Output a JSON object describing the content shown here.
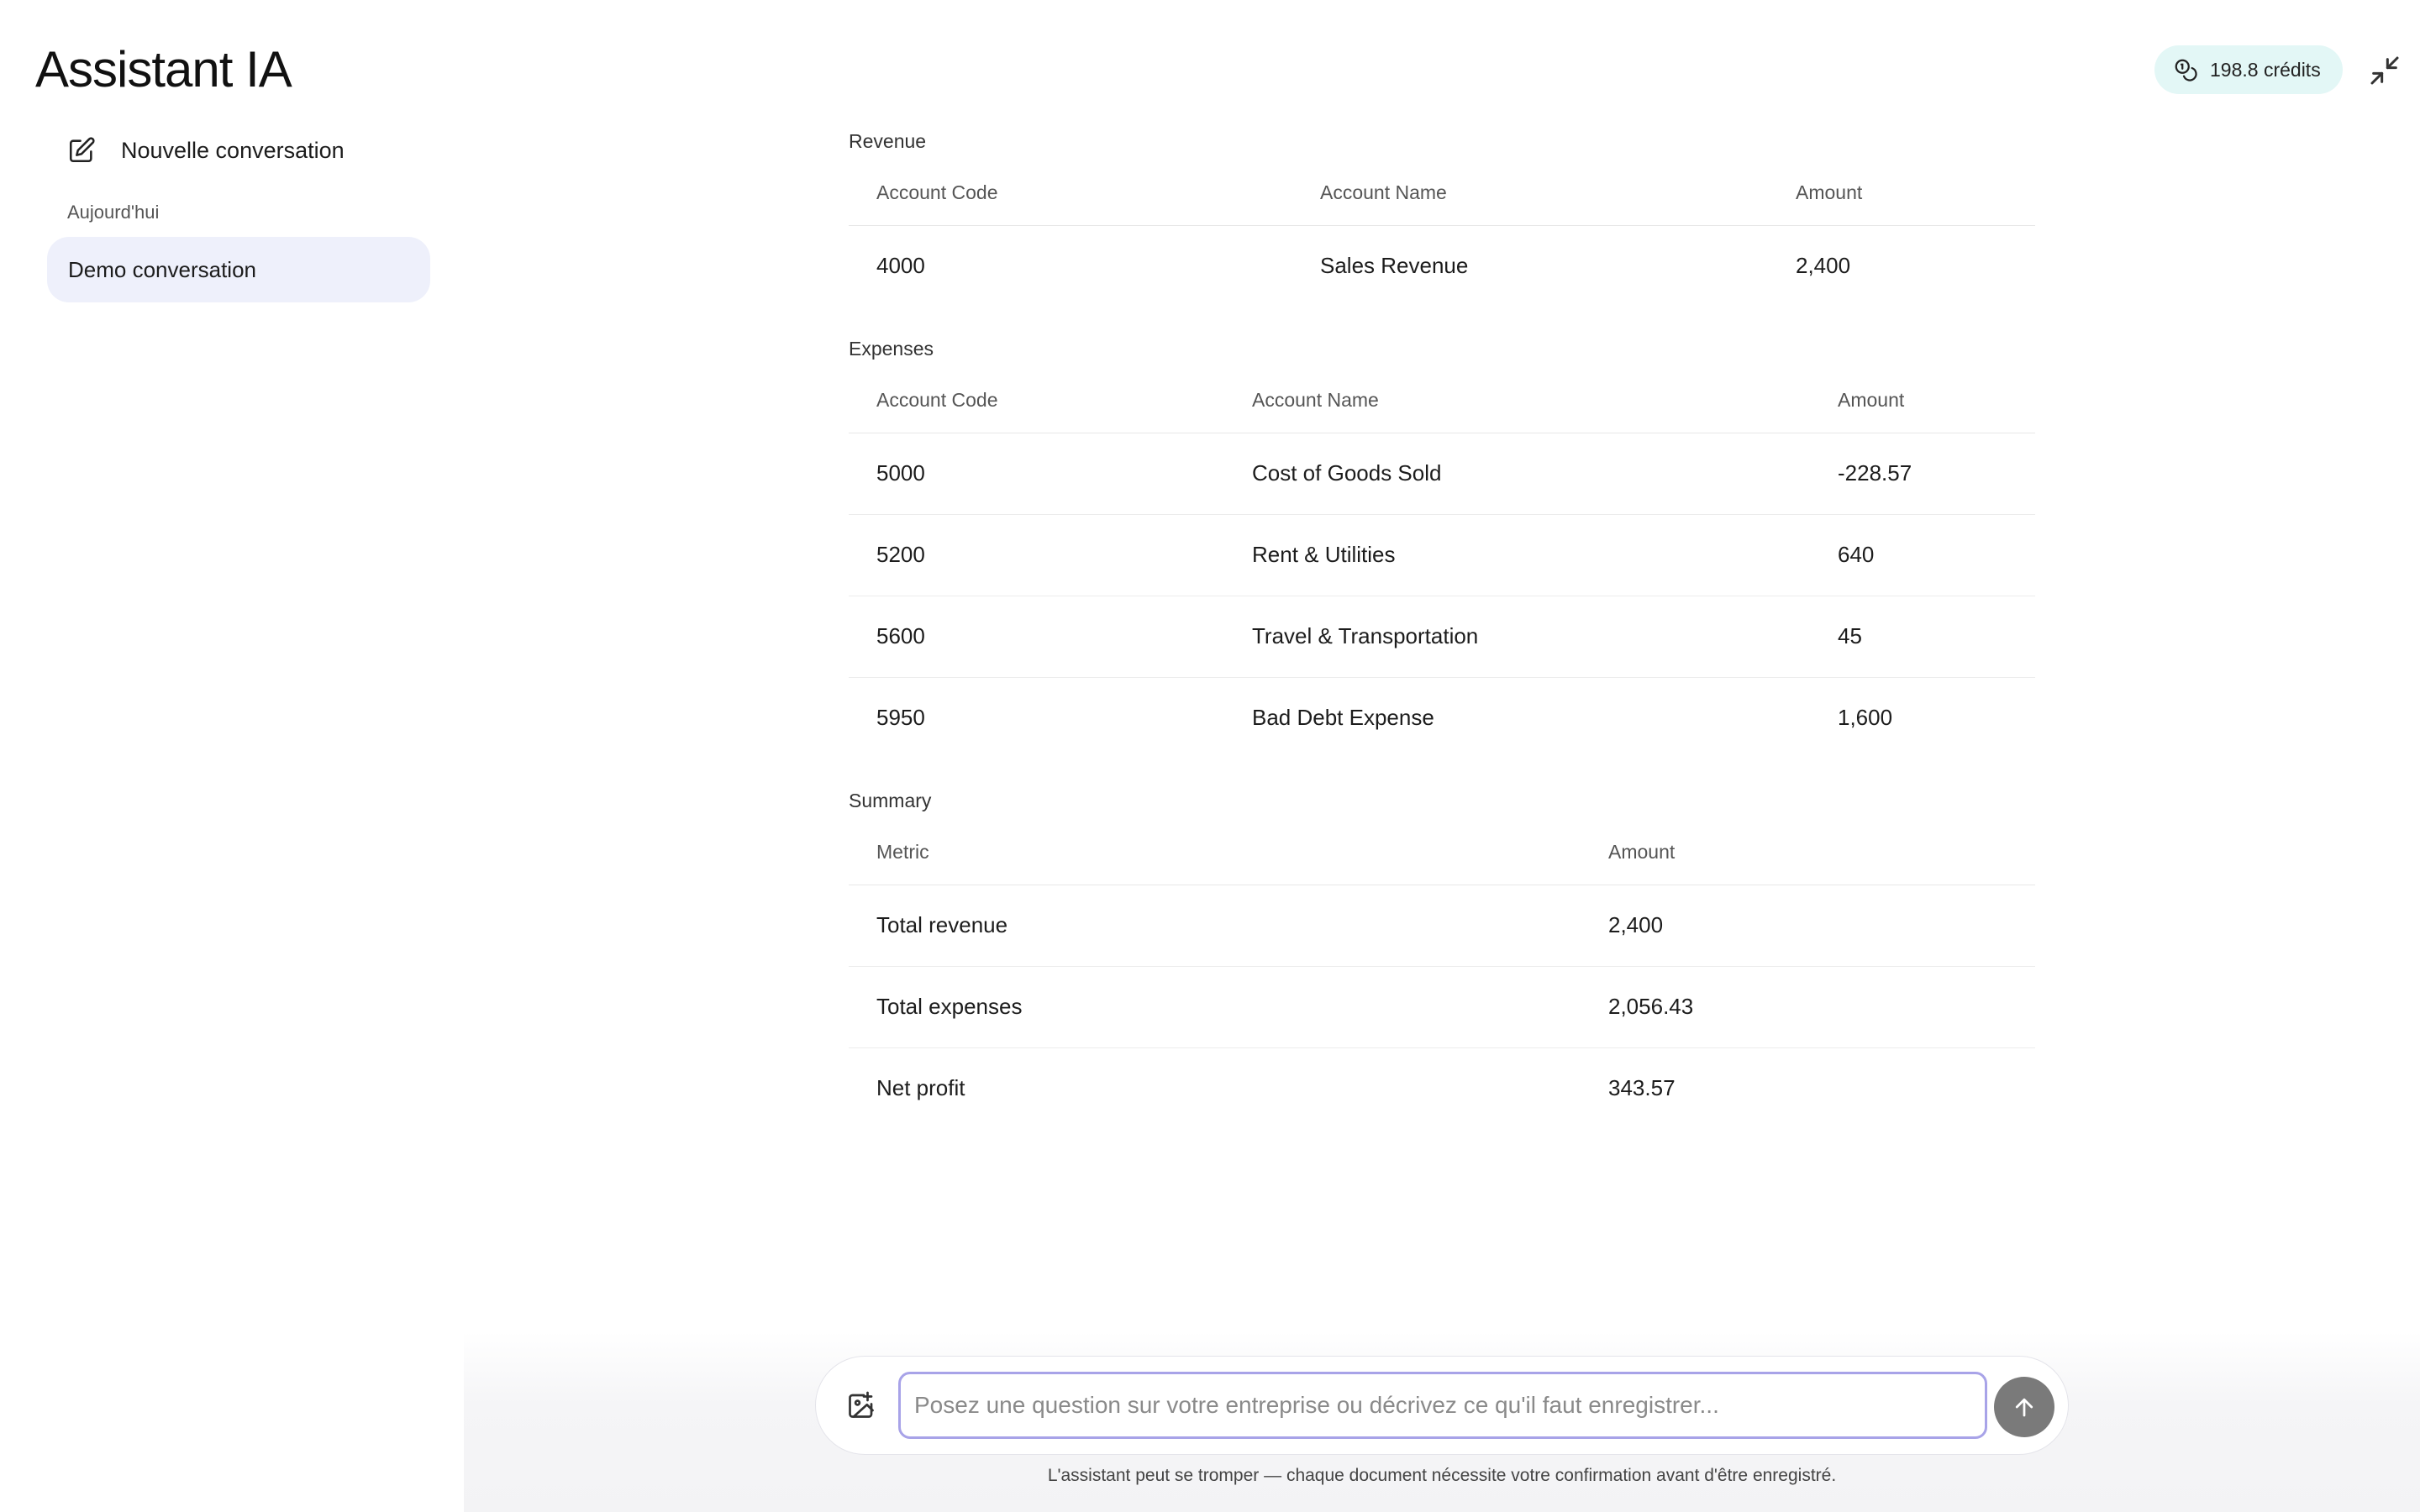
{
  "app": {
    "title": "Assistant IA"
  },
  "header": {
    "credits": "198.8 crédits"
  },
  "sidebar": {
    "new_conversation": "Nouvelle conversation",
    "section_today": "Aujourd'hui",
    "conversations": [
      {
        "label": "Demo conversation"
      }
    ]
  },
  "report": {
    "revenue": {
      "title": "Revenue",
      "columns": [
        "Account Code",
        "Account Name",
        "Amount"
      ],
      "rows": [
        [
          "4000",
          "Sales Revenue",
          "2,400"
        ]
      ]
    },
    "expenses": {
      "title": "Expenses",
      "columns": [
        "Account Code",
        "Account Name",
        "Amount"
      ],
      "rows": [
        [
          "5000",
          "Cost of Goods Sold",
          "-228.57"
        ],
        [
          "5200",
          "Rent & Utilities",
          "640"
        ],
        [
          "5600",
          "Travel & Transportation",
          "45"
        ],
        [
          "5950",
          "Bad Debt Expense",
          "1,600"
        ]
      ]
    },
    "summary": {
      "title": "Summary",
      "columns": [
        "Metric",
        "Amount"
      ],
      "rows": [
        [
          "Total revenue",
          "2,400"
        ],
        [
          "Total expenses",
          "2,056.43"
        ],
        [
          "Net profit",
          "343.57"
        ]
      ]
    }
  },
  "composer": {
    "placeholder": "Posez une question sur votre entreprise ou décrivez ce qu'il faut enregistrer...",
    "value": ""
  },
  "footer": {
    "disclaimer": "L'assistant peut se tromper — chaque document nécessite votre confirmation avant d'être enregistré."
  },
  "icons": {
    "new_conversation": "edit-icon",
    "credits": "coins-icon",
    "collapse": "minimize-icon",
    "attach": "image-plus-icon",
    "send": "arrow-up-icon"
  },
  "colors": {
    "active_conversation_bg": "#eef0fb",
    "credits_bg": "#e3f7f6",
    "input_border": "#a8a3e8",
    "send_button": "#7a7a7a"
  }
}
